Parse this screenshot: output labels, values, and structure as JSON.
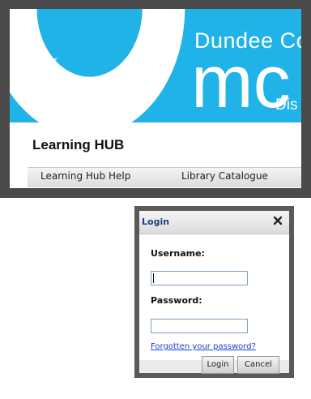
{
  "banner": {
    "line1": "Dundee Co",
    "line2": "mc",
    "line3": "Dis",
    "background_color": "#1fb3e8",
    "logo_icon": "u-shape-logo-icon"
  },
  "hub": {
    "title": "Learning HUB",
    "nav": {
      "help_label": "Learning Hub Help",
      "library_label": "Library Catalogue"
    }
  },
  "login": {
    "title": "Login",
    "close_icon": "close-icon",
    "username_label": "Username:",
    "username_value": "",
    "password_label": "Password:",
    "password_value": "",
    "forgot_link": "Forgotten your password?",
    "login_button": "Login",
    "cancel_button": "Cancel",
    "title_color": "#1e3f7a",
    "link_color": "#1a3fd6"
  }
}
